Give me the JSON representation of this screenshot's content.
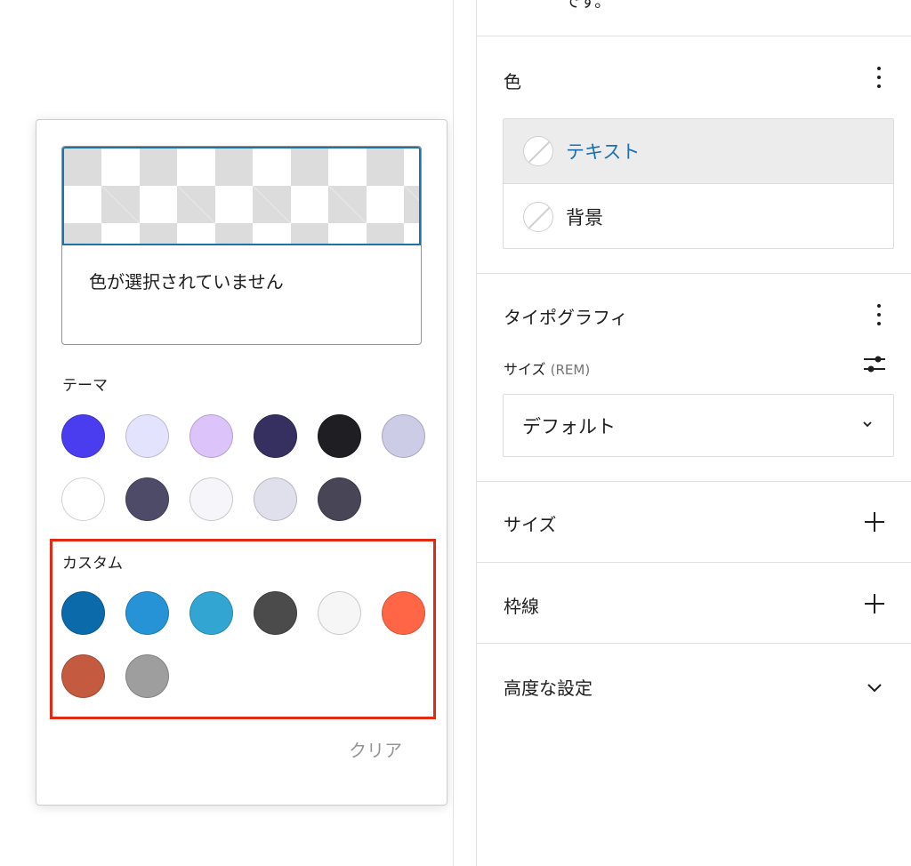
{
  "popover": {
    "no_color_text": "色が選択されていません",
    "theme_label": "テーマ",
    "theme_colors": [
      "#4a3df0",
      "#e4e3fd",
      "#dcc4fb",
      "#35305f",
      "#1e1e23",
      "#cccce6",
      "#ffffff",
      "#4e4b69",
      "#f5f5fa",
      "#e0dfec",
      "#474556"
    ],
    "custom_label": "カスタム",
    "custom_colors": [
      "#0b6aa9",
      "#2593d6",
      "#32a5d3",
      "#4b4b4b",
      "#f6f6f6",
      "#fe6645",
      "#c45a40",
      "#9e9e9e"
    ],
    "clear_label": "クリア"
  },
  "sidebar": {
    "top_cut_text": "です。",
    "color": {
      "title": "色",
      "items": [
        {
          "label": "テキスト",
          "active": true
        },
        {
          "label": "背景",
          "active": false
        }
      ]
    },
    "typography": {
      "title": "タイポグラフィ",
      "size_label": "サイズ",
      "size_unit": "(REM)",
      "select_value": "デフォルト"
    },
    "panels": {
      "size": "サイズ",
      "border": "枠線",
      "advanced": "高度な設定"
    }
  }
}
